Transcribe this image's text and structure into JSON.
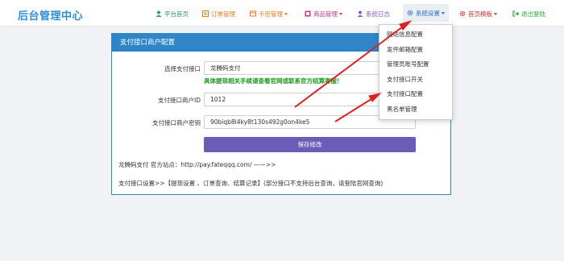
{
  "brand": "后台管理中心",
  "nav": [
    {
      "label": "平台首页",
      "icon": "user-icon",
      "color": "#2a9d6a"
    },
    {
      "label": "订单管理",
      "icon": "list-icon",
      "color": "#e07b1a"
    },
    {
      "label": "卡密管理",
      "icon": "card-icon",
      "color": "#e07b1a"
    },
    {
      "label": "商品管理",
      "icon": "goods-icon",
      "color": "#c8308e"
    },
    {
      "label": "系统日志",
      "icon": "log-icon",
      "color": "#8a5cc8"
    },
    {
      "label": "系统设置",
      "icon": "gear-icon",
      "color": "#2a6fc8"
    },
    {
      "label": "首页模板",
      "icon": "gear-icon",
      "color": "#d8322e"
    },
    {
      "label": "退出登陆",
      "icon": "logout-icon",
      "color": "#2aa83a"
    }
  ],
  "dropdown": [
    "网站信息配置",
    "发件邮箱配置",
    "管理员账号配置",
    "支付接口开关",
    "支付接口配置",
    "黑名单管理"
  ],
  "panel": {
    "title": "支付接口商户配置",
    "select_label": "选择支付接口",
    "select_value": "龙腾码支付",
    "notice": "具体提现相关手续请查看官网或联系官方结算客服！",
    "merchant_id_label": "支付接口商户ID",
    "merchant_id_value": "1012",
    "merchant_key_label": "支付接口商户密钥",
    "merchant_key_value": "90biqb8l4ky8t130s492g0on4ke5",
    "save_label": "保存修改",
    "footer_site": "龙腾码支付      官方站点：http://pay.fateqqq.com/ ——>>",
    "footer_settings": "支付接口设置>>【提现设置 、订单查询、结算记录】(部分接口不支持后台查询，请登陆官网查询)"
  },
  "colors": {
    "brand": "#2a8fd8",
    "panel_header": "#2e86c8",
    "save_button": "#6b5cb8",
    "notice": "#1a9a1a",
    "annotation_arrow": "#e02020"
  }
}
